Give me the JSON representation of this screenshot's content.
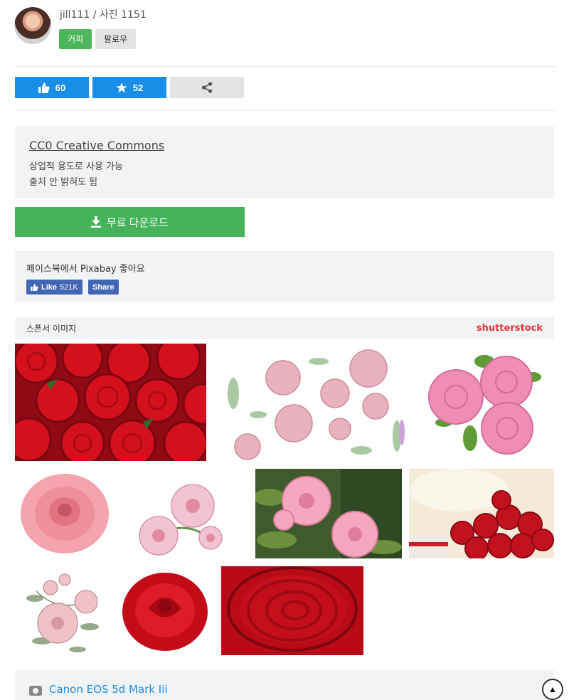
{
  "user": {
    "name_photos": "jill111 / 사진 1151",
    "coffee_label": "커피",
    "follow_label": "팔로우"
  },
  "actions": {
    "likes": "60",
    "favorites": "52"
  },
  "license": {
    "title": "CC0 Creative Commons",
    "line1": "상업적 용도로 사용 가능",
    "line2": "출처 안 밝혀도 됨"
  },
  "download_label": "무료 다운로드",
  "facebook": {
    "text": "페이스북에서 Pixabay 좋아요",
    "like_label": "Like",
    "like_count": "521K",
    "share_label": "Share"
  },
  "sponsor": {
    "label": "스폰서 이미지",
    "brand": "shutterstock"
  },
  "images": [
    {
      "name": "red-roses-image",
      "style": "red-cluster"
    },
    {
      "name": "watercolor-roses-image",
      "style": "watercolor"
    },
    {
      "name": "pink-roses-image",
      "style": "pink-bouquet"
    },
    {
      "name": "pink-rose-single-image",
      "style": "pink-single"
    },
    {
      "name": "pink-roses-branch-image",
      "style": "pink-branch"
    },
    {
      "name": "pink-roses-garden-image",
      "style": "garden"
    },
    {
      "name": "red-roses-gift-image",
      "style": "red-gift"
    },
    {
      "name": "vintage-rose-drawing-image",
      "style": "drawing"
    },
    {
      "name": "red-rose-single-image",
      "style": "red-single"
    },
    {
      "name": "red-rose-closeup-image",
      "style": "red-closeup"
    }
  ],
  "camera": "Canon EOS 5d Mark Iii",
  "icons": {
    "thumb": "thumbs-up-icon",
    "star": "star-icon",
    "share": "share-icon",
    "download": "download-icon",
    "camera": "camera-icon",
    "top": "scroll-top-icon"
  }
}
